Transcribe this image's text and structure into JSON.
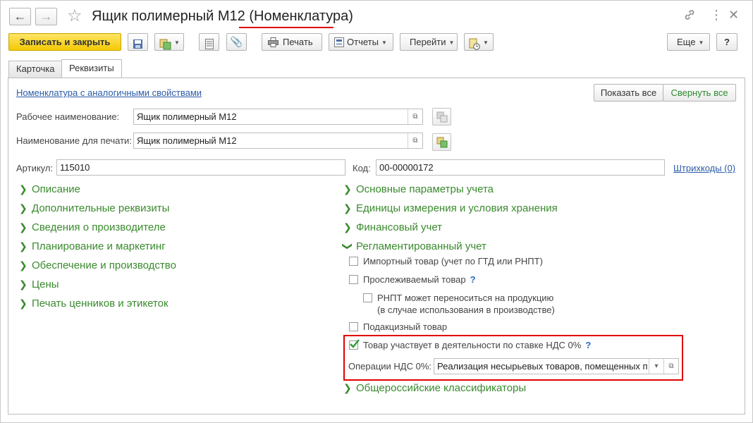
{
  "window": {
    "title_main": "Ящик полимерный М12",
    "title_type": "(Номенклатура)"
  },
  "icons": {
    "back": "arrow-left-icon",
    "forward": "arrow-right-icon",
    "favorite": "star-icon",
    "link": "link-icon",
    "more": "more-vert-icon",
    "close": "close-icon",
    "print": "printer-icon",
    "attach": "paperclip-icon"
  },
  "colors": {
    "primary_button": "#f5c905",
    "group_header": "#3a8a2e",
    "link": "#2a5ba7",
    "highlight_frame": "#e00000",
    "check": "#2e9a36"
  },
  "toolbar": {
    "save_close": "Записать и закрыть",
    "print": "Печать",
    "reports": "Отчеты",
    "goto": "Перейти",
    "more": "Еще",
    "help": "?"
  },
  "tabs": [
    {
      "label": "Карточка"
    },
    {
      "label": "Реквизиты"
    }
  ],
  "form": {
    "similar_link": "Номенклатура с аналогичными свойствами",
    "show_all": "Показать все",
    "collapse_all": "Свернуть все",
    "working_name_label": "Рабочее наименование:",
    "working_name_value": "Ящик полимерный М12",
    "print_name_label": "Наименование для печати:",
    "print_name_value": "Ящик полимерный М12",
    "article_label": "Артикул:",
    "article_value": "115010",
    "code_label": "Код:",
    "code_value": "00-00000172",
    "barcodes_link": "Штрихкоды (0)"
  },
  "groups_left": [
    "Описание",
    "Дополнительные реквизиты",
    "Сведения о производителе",
    "Планирование и маркетинг",
    "Обеспечение и производство",
    "Цены",
    "Печать ценников и этикеток"
  ],
  "groups_right": [
    "Основные параметры учета",
    "Единицы измерения и условия хранения",
    "Финансовый учет",
    "Регламентированный учет"
  ],
  "regulated": {
    "import_goods": {
      "label": "Импортный товар (учет по ГТД или РНПТ)",
      "checked": false
    },
    "traceable": {
      "label": "Прослеживаемый товар",
      "help": "?",
      "checked": false
    },
    "rnpt_line1": "РНПТ может переноситься на продукцию",
    "rnpt_line2": "(в случае использования в производстве)",
    "rnpt_checked": false,
    "excise": {
      "label": "Подакцизный товар",
      "checked": false
    },
    "vat0": {
      "label": "Товар участвует в деятельности по ставке НДС 0%",
      "help": "?",
      "checked": true
    },
    "vat0_ops_label": "Операции НДС 0%:",
    "vat0_ops_value": "Реализация несырьевых товаров, помещенных п"
  },
  "classifiers_group": "Общероссийские классификаторы"
}
